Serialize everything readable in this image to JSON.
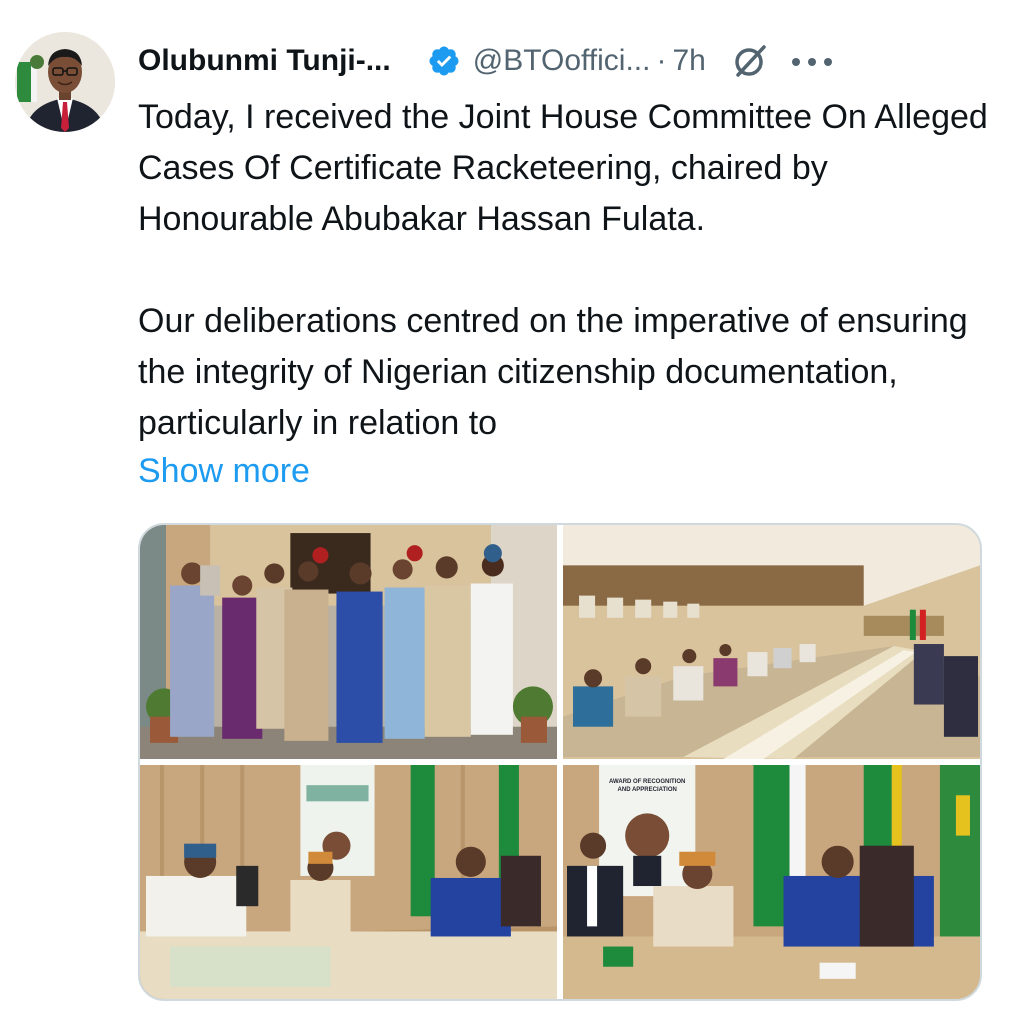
{
  "tweet": {
    "author_name": "Olubunmi Tunji-...",
    "handle": "@BTOoffici...",
    "separator": "·",
    "time": "7h",
    "paragraphs": [
      "Today, I received the Joint House Committee On Alleged Cases Of Certificate Racketeering, chaired by Honourable Abubakar Hassan Fulata.",
      "Our deliberations centred on the imperative of ensuring the integrity of Nigerian citizenship documentation, particularly in relation to"
    ],
    "show_more": "Show more",
    "banner_text": "AWARD OF RECOGNITION AND APPRECIATION"
  },
  "icons": {
    "verified": "verified-badge-icon",
    "grok": "grok-icon",
    "more": "more-options-icon"
  },
  "colors": {
    "text": "#0f1419",
    "secondary": "#536471",
    "link": "#1d9bf0",
    "verified": "#1d9bf0",
    "border": "#cfd9de"
  }
}
